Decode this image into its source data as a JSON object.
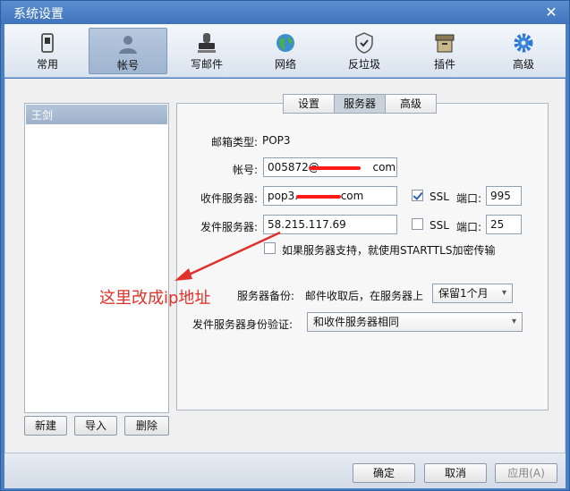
{
  "window": {
    "title": "系统设置",
    "close_glyph": "✕"
  },
  "toolbar": {
    "items": [
      {
        "label": "常用",
        "icon": "phone-icon"
      },
      {
        "label": "帐号",
        "icon": "user-icon",
        "active": true
      },
      {
        "label": "写邮件",
        "icon": "stamp-icon"
      },
      {
        "label": "网络",
        "icon": "globe-icon"
      },
      {
        "label": "反垃圾",
        "icon": "shield-icon"
      },
      {
        "label": "插件",
        "icon": "box-icon"
      },
      {
        "label": "高级",
        "icon": "gear-icon"
      }
    ]
  },
  "accounts": {
    "items": [
      "王剑"
    ],
    "buttons": {
      "new": "新建",
      "import": "导入",
      "delete": "删除"
    }
  },
  "tabs": [
    {
      "label": "设置"
    },
    {
      "label": "服务器",
      "active": true
    },
    {
      "label": "高级"
    }
  ],
  "server": {
    "mailbox_type_label": "邮箱类型:",
    "mailbox_type_value": "POP3",
    "account_label": "帐号:",
    "account_value": "005872@",
    "account_suffix": "com",
    "incoming_label": "收件服务器:",
    "incoming_value": "pop3.",
    "incoming_suffix": "com",
    "incoming_ssl_label": "SSL",
    "incoming_ssl_checked": true,
    "port_label": "端口:",
    "incoming_port": "995",
    "outgoing_label": "发件服务器:",
    "outgoing_value": "58.215.117.69",
    "outgoing_ssl_label": "SSL",
    "outgoing_ssl_checked": false,
    "outgoing_port": "25",
    "starttls_label": "如果服务器支持，就使用STARTTLS加密传输",
    "backup_label": "服务器备份:",
    "backup_desc": "邮件收取后，在服务器上",
    "backup_value": "保留1个月",
    "auth_label": "发件服务器身份验证:",
    "auth_value": "和收件服务器相同"
  },
  "annotation": {
    "text": "这里改成ip地址",
    "color": "#e0302a"
  },
  "footer": {
    "ok": "确定",
    "cancel": "取消",
    "apply": "应用(A)"
  },
  "colors": {
    "accent": "#4a7fc3",
    "redaction": "#ff1a1a"
  }
}
